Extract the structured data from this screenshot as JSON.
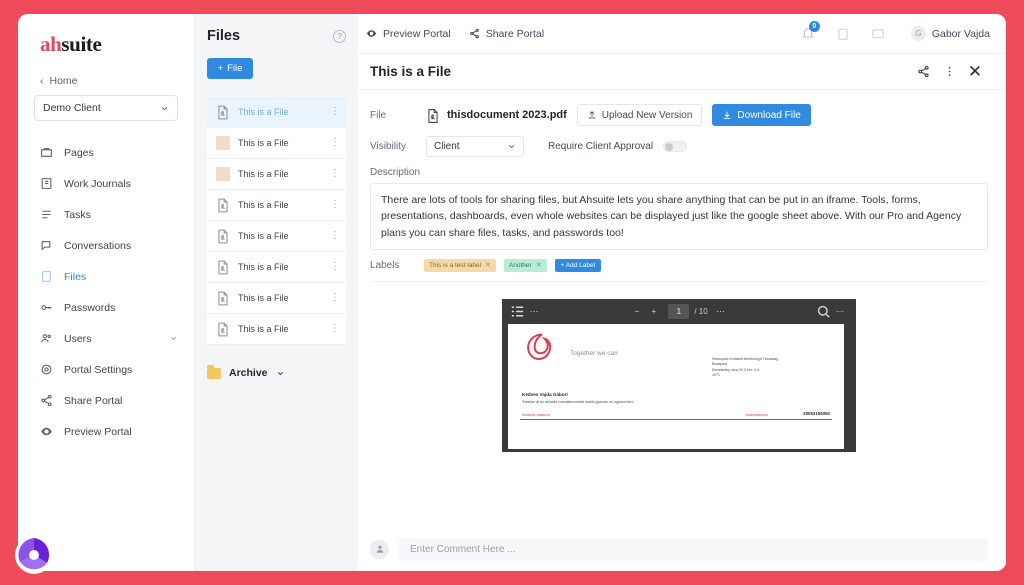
{
  "brand": {
    "prefix": "ah",
    "suffix": "suite",
    "accent": "#e04a5f"
  },
  "sidebar": {
    "home_label": "Home",
    "client_select": {
      "value": "Demo Client",
      "caret": "chevron-down-icon"
    },
    "items": [
      {
        "label": "Pages",
        "icon": "pages-icon",
        "active": false,
        "caret": false
      },
      {
        "label": "Work Journals",
        "icon": "journal-icon",
        "active": false,
        "caret": false
      },
      {
        "label": "Tasks",
        "icon": "tasks-icon",
        "active": false,
        "caret": false
      },
      {
        "label": "Conversations",
        "icon": "conversations-icon",
        "active": false,
        "caret": false
      },
      {
        "label": "Files",
        "icon": "files-icon",
        "active": true,
        "caret": false
      },
      {
        "label": "Passwords",
        "icon": "key-icon",
        "active": false,
        "caret": false
      },
      {
        "label": "Users",
        "icon": "users-icon",
        "active": false,
        "caret": true
      },
      {
        "label": "Portal Settings",
        "icon": "gear-icon",
        "active": false,
        "caret": false
      },
      {
        "label": "Share Portal",
        "icon": "share-icon",
        "active": false,
        "caret": false
      },
      {
        "label": "Preview Portal",
        "icon": "eye-icon",
        "active": false,
        "caret": false
      }
    ]
  },
  "files_panel": {
    "title": "Files",
    "help_icon": "help-circle-icon",
    "add_button": "File",
    "add_button_icon": "plus-icon",
    "rows": [
      {
        "name": "This is a File",
        "kind": "pdf",
        "selected": true
      },
      {
        "name": "This is a File",
        "kind": "image",
        "selected": false
      },
      {
        "name": "This is a File",
        "kind": "image",
        "selected": false
      },
      {
        "name": "This is a File",
        "kind": "pdf",
        "selected": false
      },
      {
        "name": "This is a File",
        "kind": "pdf",
        "selected": false
      },
      {
        "name": "This is a File",
        "kind": "pdf",
        "selected": false
      },
      {
        "name": "This is a File",
        "kind": "pdf",
        "selected": false
      },
      {
        "name": "This is a File",
        "kind": "pdf",
        "selected": false
      }
    ],
    "archive_label": "Archive"
  },
  "topbar": {
    "preview_portal": "Preview Portal",
    "share_portal": "Share Portal",
    "notification_count": "0",
    "user_name": "Gabor Vajda",
    "user_initial": "G"
  },
  "file_header": {
    "title": "This is a File",
    "share_icon": "share-icon",
    "more_icon": "more-vertical-icon",
    "close_icon": "close-icon"
  },
  "detail": {
    "file_label": "File",
    "file_name": "thisdocument 2023.pdf",
    "upload_button": "Upload New Version",
    "download_button": "Download File",
    "visibility_label": "Visibility",
    "visibility_value": "Client",
    "approval_label": "Require Client Approval",
    "approval_on": false,
    "description_label": "Description",
    "description_text": "There are lots of tools for sharing files, but Ahsuite lets you share anything that can be put in an iframe. Tools, forms, presentations, dashboards, even whole websites can be displayed just like the google sheet above. With our Pro and Agency plans you can share files, tasks, and passwords too!",
    "labels_label": "Labels",
    "labels": [
      {
        "text": "This is a test label",
        "bg": "#f6d9a8",
        "fg": "#8a6a2e"
      },
      {
        "text": "Another",
        "bg": "#b9ecd5",
        "fg": "#2f7a56"
      }
    ],
    "add_label_button": "+ Add Label"
  },
  "pdf_viewer": {
    "sidebar_icon": "thumbnails-icon",
    "more_left_icon": "more-horizontal-icon",
    "zoom_out_icon": "minus-icon",
    "zoom_in_icon": "plus-icon",
    "page_current": "1",
    "page_total": "/ 10",
    "page_more_icon": "more-horizontal-icon",
    "search_icon": "search-icon",
    "more_right_icon": "more-horizontal-icon",
    "document": {
      "tagline": "Together we can",
      "address": "Seaxoport Korlátolt felelősségű Társaság\nBudapest\nDembsutky utca 20 2 em. 4 a.\n1071",
      "greeting": "Kedves  Vajda Gábor!",
      "subline": "Tekintse át az aktuális számlakivonatát alábbi gyorsan és egyszerűen!",
      "left_label": "Számla adatom",
      "right_label": "Számlaszám",
      "right_value": "30053159392"
    }
  },
  "comment": {
    "avatar_icon": "user-avatar-icon",
    "placeholder": "Enter Comment Here ..."
  }
}
